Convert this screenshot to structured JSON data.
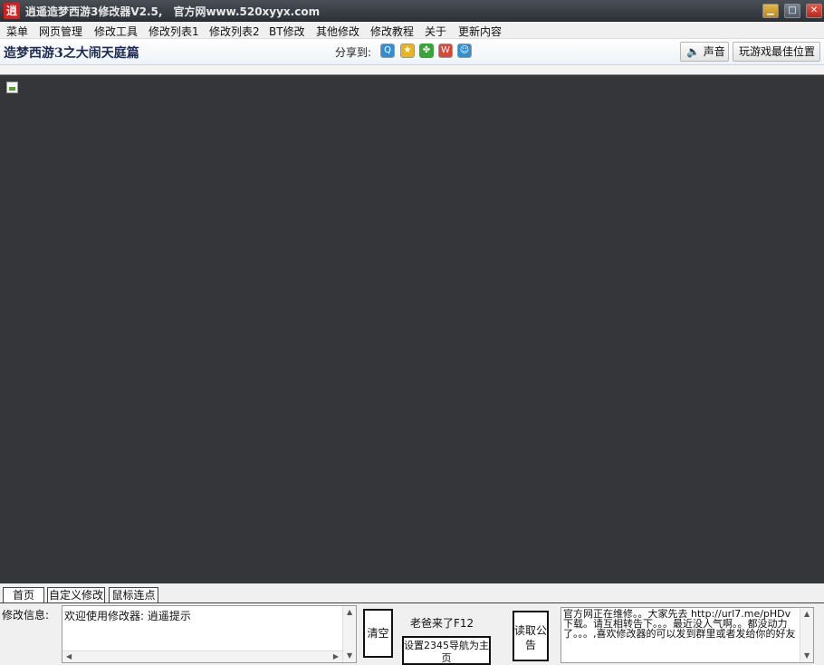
{
  "window": {
    "app_icon": "逍",
    "title": "逍遥造梦西游3修改器V2.5,　官方网www.520xyyx.com",
    "controls": {
      "minimize_icon": "minimize-icon",
      "maximize_icon": "maximize-icon",
      "close_icon": "close-icon"
    }
  },
  "menu": {
    "items": [
      {
        "label": "菜单"
      },
      {
        "label": "网页管理"
      },
      {
        "label": "修改工具"
      },
      {
        "label": "修改列表1"
      },
      {
        "label": "修改列表2"
      },
      {
        "label": "BT修改"
      },
      {
        "label": "其他修改"
      },
      {
        "label": "修改教程"
      },
      {
        "label": "关于"
      },
      {
        "label": "更新内容"
      }
    ]
  },
  "toolbar": {
    "game_title": "造梦西游3之大闹天庭篇",
    "share_label": "分享到:",
    "share_icons": [
      "qzone-icon",
      "star-icon",
      "clover-icon",
      "weibo-icon",
      "qq-icon"
    ],
    "sound_label": "声音",
    "best_position_label": "玩游戏最佳位置"
  },
  "bottom": {
    "tabs": [
      {
        "label": "首页"
      },
      {
        "label": "自定义修改"
      },
      {
        "label": "鼠标连点"
      }
    ],
    "info_label": "修改信息:",
    "info_text": "欢迎使用修改器: 逍遥提示",
    "clear_label": "清空",
    "boss_key_label": "老爸来了F12",
    "set_home_label": "设置2345导航为主页",
    "read_notice_label": "读取公告",
    "notice_text": "官方网正在维修。。大家先去 http://url7.me/pHDv下载。请互相转告下。。。最近没人气啊。。都没动力了。。。,喜欢修改器的可以发到群里或者发给你的好友"
  },
  "colors": {
    "game_area": "#35363a",
    "title_bar": "#3a3e45",
    "close_button": "#c9352a",
    "game_title": "#1a2a52"
  }
}
